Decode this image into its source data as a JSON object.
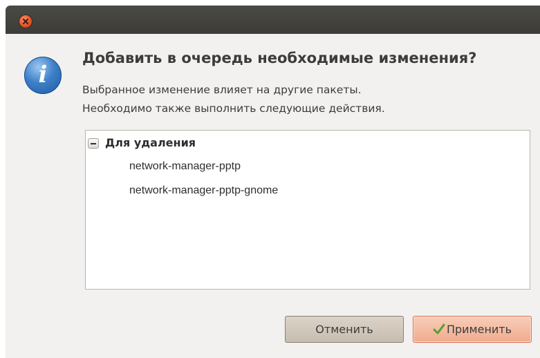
{
  "dialog": {
    "heading": "Добавить в очередь необходимые изменения?",
    "description_line1": "Выбранное изменение влияет на другие пакеты.",
    "description_line2": "Необходимо также выполнить следующие действия.",
    "icon": "info-icon"
  },
  "titlebar": {
    "close_icon": "close-icon"
  },
  "changes": {
    "group_label": "Для удаления",
    "expander_state": "expanded",
    "packages": [
      "network-manager-pptp",
      "network-manager-pptp-gnome"
    ]
  },
  "buttons": {
    "cancel_label": "Отменить",
    "apply_label": "Применить",
    "apply_icon": "checkmark-icon"
  },
  "colors": {
    "titlebar": "#3d3c38",
    "close_button": "#e2572a",
    "apply_button": "#f0ab8e",
    "apply_check": "#55a12a",
    "info_icon": "#3d7fc8"
  }
}
